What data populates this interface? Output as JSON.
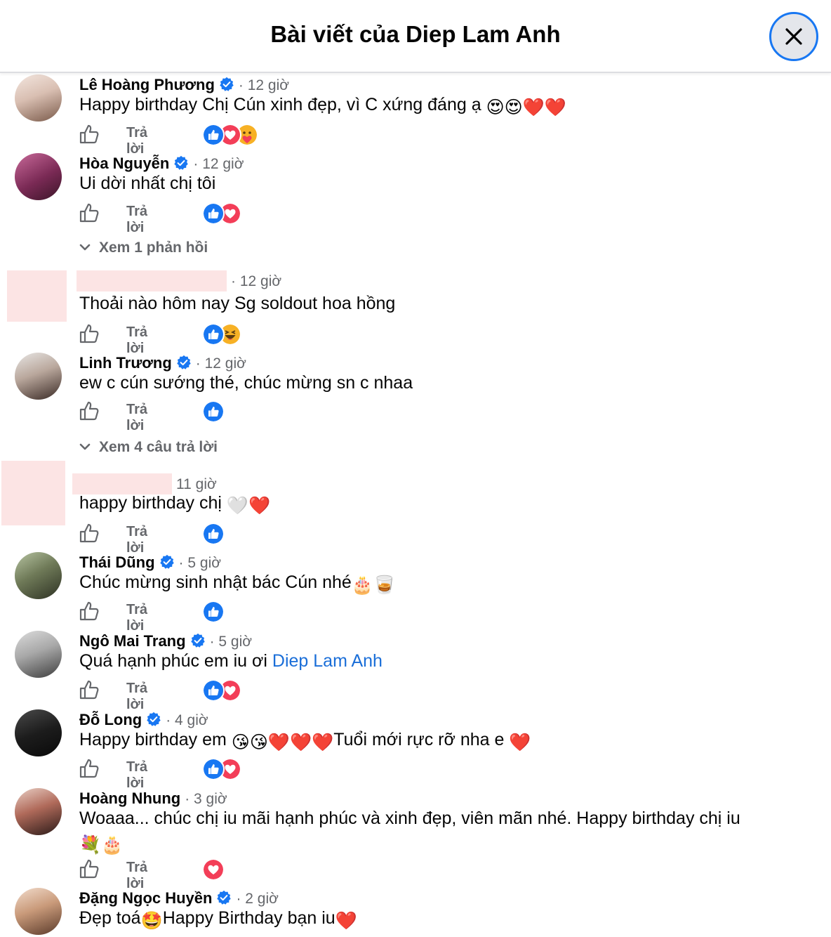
{
  "header": {
    "title": "Bài viết của Diep Lam Anh"
  },
  "reply_label": "Trả lời",
  "comments": [
    {
      "name": "Lê Hoàng Phương",
      "time": "12 giờ",
      "text": "Happy birthday Chị Cún xinh đẹp, vì C xứng đáng ạ",
      "emoji": "😍😍❤️❤️",
      "reactions": [
        "like",
        "love",
        "care"
      ]
    },
    {
      "name": "Hòa Nguyễn",
      "time": "12 giờ",
      "text": "Ui dời nhất chị tôi",
      "reactions": [
        "like",
        "love"
      ]
    },
    {
      "name": "",
      "time": "12 giờ",
      "text": "Thoải nào hôm nay Sg soldout hoa hồng",
      "reactions": [
        "like",
        "haha"
      ]
    },
    {
      "name": "Linh Trương",
      "time": "12 giờ",
      "text": "ew c cún sướng thé, chúc mừng sn c nhaa",
      "reactions": [
        "like"
      ]
    },
    {
      "name": "",
      "time": "11 giờ",
      "text": "happy birthday chị",
      "emoji": "🤍❤️",
      "reactions": [
        "like"
      ]
    },
    {
      "name": "Thái Dũng",
      "time": "5 giờ",
      "text": "Chúc mừng sinh nhật bác Cún nhé",
      "emoji": "🎂🥃",
      "reactions": [
        "like"
      ]
    },
    {
      "name": "Ngô Mai Trang",
      "time": "5 giờ",
      "text": "Quá hạnh phúc em iu ơi",
      "mention": "Diep Lam Anh",
      "reactions": [
        "like",
        "love"
      ]
    },
    {
      "name": "Đỗ Long",
      "time": "4 giờ",
      "text_a": "Happy birthday em",
      "emoji_a": "😘😘❤️❤️❤️",
      "text_b": "Tuổi mới rực rỡ nha e",
      "emoji_b": "❤️",
      "reactions": [
        "like",
        "love"
      ]
    },
    {
      "name": "Hoàng Nhung",
      "time": "3 giờ",
      "text": "Woaaa... chúc chị iu mãi hạnh phúc và xinh đẹp, viên mãn nhé. Happy birthday chị iu",
      "emoji": "💐🎂",
      "reactions": [
        "love"
      ]
    },
    {
      "name": "Đặng Ngọc Huyền",
      "time": "2 giờ",
      "text_a": "Đẹp toá",
      "emoji_a": "🤩",
      "text_b": "Happy Birthday bạn iu",
      "emoji_b": "❤️"
    }
  ],
  "view_replies": [
    {
      "label": "Xem 1 phản hồi"
    },
    {
      "label": "Xem 4 câu trả lời"
    }
  ],
  "colors": {
    "accent": "#1877f2",
    "like": "#1877f2",
    "love": "#f33e58",
    "secondary_text": "#65676b",
    "mention": "#1a6ed8"
  }
}
